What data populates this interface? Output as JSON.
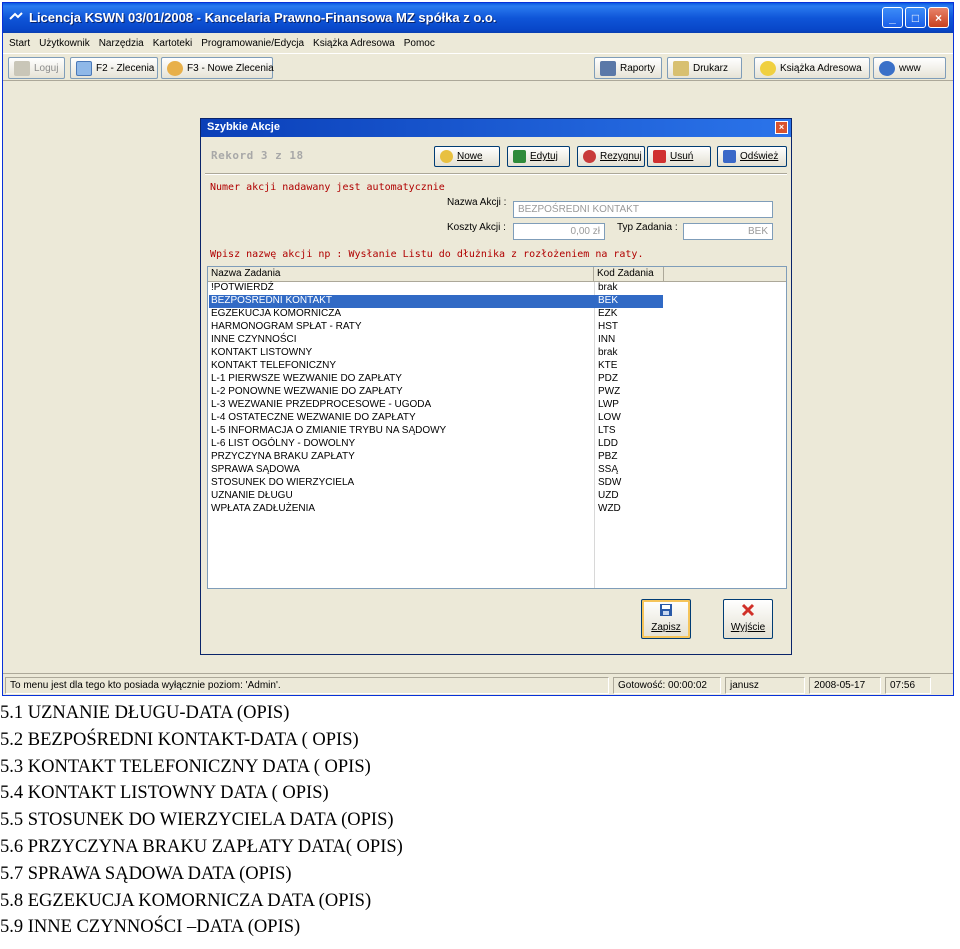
{
  "window": {
    "title": "Licencja KSWN 03/01/2008 - Kancelaria Prawno-Finansowa MZ spółka z o.o.",
    "controls": [
      "_",
      "□",
      "×"
    ]
  },
  "menu": [
    "Start",
    "Użytkownik",
    "Narzędzia",
    "Kartoteki",
    "Programowanie/Edycja",
    "Książka Adresowa",
    "Pomoc"
  ],
  "toolbar": {
    "login": "Loguj",
    "zlecenia": "F2 - Zlecenia",
    "nowe_zlecenia": "F3 - Nowe Zlecenia",
    "raporty": "Raporty",
    "drukarz": "Drukarz",
    "ksiazka": "Książka Adresowa",
    "www": "www"
  },
  "dialog": {
    "title": "Szybkie Akcje",
    "close": "×",
    "record": "Rekord 3 z 18",
    "buttons": {
      "nowe": "Nowe",
      "edytuj": "Edytuj",
      "rezygnuj": "Rezygnuj",
      "usun": "Usuń",
      "odswiez": "Odśwież"
    },
    "note_auto": "Numer akcji nadawany jest automatycznie",
    "nazwa_label": "Nazwa Akcji :",
    "nazwa_value": "BEZPOŚREDNI KONTAKT",
    "koszty_label": "Koszty Akcji :",
    "koszty_value": "0,00 zł",
    "typ_label": "Typ Zadania :",
    "typ_value": "BEK",
    "note_example": "Wpisz nazwę akcji np :  Wysłanie Listu do dłużnika z rozłożeniem na raty.",
    "grid": {
      "headers": [
        "Nazwa Zadania",
        "Kod Zadania"
      ],
      "rows": [
        {
          "name": "!POTWIERDŹ",
          "code": "brak"
        },
        {
          "name": "BEZPOŚREDNI KONTAKT",
          "code": "BEK"
        },
        {
          "name": "EGZEKUCJA KOMORNICZA",
          "code": "EZK"
        },
        {
          "name": "HARMONOGRAM SPŁAT - RATY",
          "code": "HST"
        },
        {
          "name": "INNE CZYNNOŚCI",
          "code": "INN"
        },
        {
          "name": "KONTAKT LISTOWNY",
          "code": "brak"
        },
        {
          "name": "KONTAKT TELEFONICZNY",
          "code": "KTE"
        },
        {
          "name": "L-1 PIERWSZE WEZWANIE DO ZAPŁATY",
          "code": "PDZ"
        },
        {
          "name": "L-2 PONOWNE WEZWANIE DO ZAPŁATY",
          "code": "PWZ"
        },
        {
          "name": "L-3 WEZWANIE PRZEDPROCESOWE - UGODA",
          "code": "LWP"
        },
        {
          "name": "L-4 OSTATECZNE WEZWANIE DO ZAPŁATY",
          "code": "LOW"
        },
        {
          "name": "L-5 INFORMACJA O ZMIANIE TRYBU NA SĄDOWY",
          "code": "LTS"
        },
        {
          "name": "L-6 LIST OGÓLNY - DOWOLNY",
          "code": "LDD"
        },
        {
          "name": "PRZYCZYNA BRAKU ZAPŁATY",
          "code": "PBZ"
        },
        {
          "name": "SPRAWA SĄDOWA",
          "code": "SSĄ"
        },
        {
          "name": "STOSUNEK DO WIERZYCIELA",
          "code": "SDW"
        },
        {
          "name": "UZNANIE DŁUGU",
          "code": "UZD"
        },
        {
          "name": "WPŁATA ZADŁUŻENIA",
          "code": "WZD"
        }
      ],
      "selected_index": 1
    },
    "zapisz": "Zapisz",
    "wyjscie": "Wyjście"
  },
  "status": {
    "message": "To menu jest dla tego kto posiada wyłącznie poziom: 'Admin'.",
    "gotowosc": "Gotowość: 00:00:02",
    "user": "janusz",
    "date": "2008-05-17",
    "time": "07:56"
  },
  "doc_lines": [
    "5.1 UZNANIE DŁUGU-DATA (OPIS)",
    "5.2 BEZPOŚREDNI KONTAKT-DATA ( OPIS)",
    "5.3 KONTAKT TELEFONICZNY DATA ( OPIS)",
    "5.4 KONTAKT LISTOWNY DATA ( OPIS)",
    "5.5 STOSUNEK DO WIERZYCIELA DATA (OPIS)",
    "5.6 PRZYCZYNA BRAKU ZAPŁATY DATA( OPIS)",
    "5.7 SPRAWA SĄDOWA DATA (OPIS)",
    "5.8 EGZEKUCJA KOMORNICZA DATA (OPIS)",
    "5.9 INNE CZYNNOŚCI –DATA (OPIS)"
  ]
}
